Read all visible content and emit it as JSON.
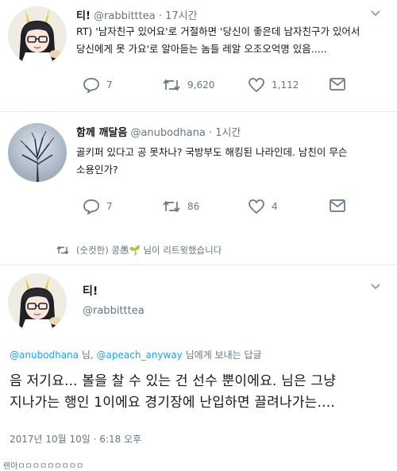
{
  "tweet1": {
    "name": "티!",
    "handle": "@rabbitttea",
    "time": "· 17시간",
    "text_line1": "RT) '남자친구 있어요'로 거절하면 '당신이 좋은데 남자친구가 있어서",
    "text_line2": "당신에게 못 가요'로 알아듣는 놈들 레알 오조오억명 있음.....",
    "stats": {
      "replies": "7",
      "retweets": "9,620",
      "likes": "1,112"
    }
  },
  "tweet2": {
    "name": "함께 깨달음",
    "handle": "@anubodhana",
    "time": "· 1시간",
    "text_line1": "골키퍼 있다고 공 못차나? 국방부도 해킹된 나라인데. 남친이 무슨",
    "text_line2": "소용인가?",
    "stats": {
      "replies": "7",
      "retweets": "86",
      "likes": "4"
    }
  },
  "retweet_note": "(숫컷한) 콩愚🌱 님이 리트윗했습니다",
  "main": {
    "name": "티!",
    "handle": "@rabbitttea",
    "reply_mention1": "@anubodhana",
    "reply_sep": " 님, ",
    "reply_mention2": "@apeach_anyway",
    "reply_suffix": " 님에게 보내는 답글",
    "text_line1": "음 저기요... 볼을 찰 수 있는 건 선수 뿐이에요. 님은 그냥",
    "text_line2": "지나가는 행인 1이에요 경기장에 난입하면 끌려나가는....",
    "timestamp": "2017년 10월 10일 · 6:18 오후"
  },
  "footer": "렌아ㅁㅁㅁㅁㅁㅁㅁㅁㅁ",
  "colors": {
    "accent": "#1da1f2",
    "muted": "#657786",
    "text": "#14171a",
    "divider": "#e1e8ed"
  }
}
